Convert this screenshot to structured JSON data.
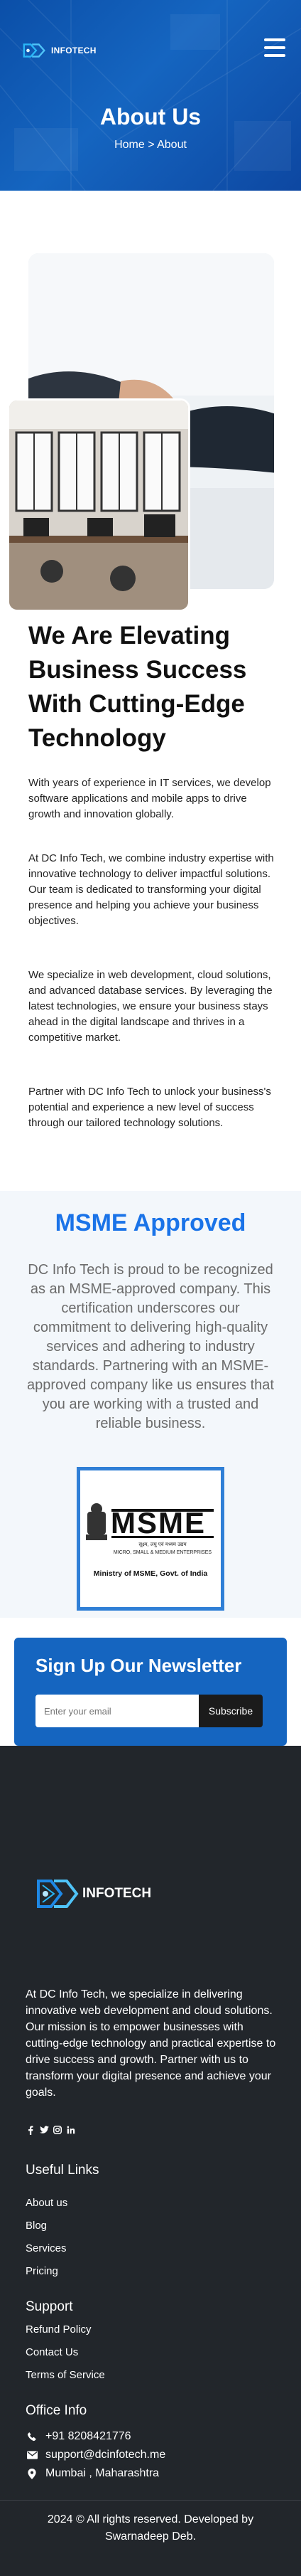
{
  "header": {
    "logo_text": "INFOTECH",
    "title": "About Us",
    "breadcrumb_home": "Home",
    "breadcrumb_sep": " > ",
    "breadcrumb_current": "About"
  },
  "about": {
    "title": "We Are Elevating Business Success With Cutting-Edge Technology",
    "paragraphs": [
      "With years of experience in IT services, we develop software applications and mobile apps to drive growth and innovation globally.",
      "At DC Info Tech, we combine industry expertise with innovative technology to deliver impactful solutions. Our team is dedicated to transforming your digital presence and helping you achieve your business objectives.",
      "We specialize in web development, cloud solutions, and advanced database services. By leveraging the latest technologies, we ensure your business stays ahead in the digital landscape and thrives in a competitive market.",
      "Partner with DC Info Tech to unlock your business's potential and experience a new level of success through our tailored technology solutions."
    ]
  },
  "msme": {
    "title": "MSME Approved",
    "text": "DC Info Tech is proud to be recognized as an MSME-approved company. This certification underscores our commitment to delivering high-quality services and adhering to industry standards. Partnering with an MSME-approved company like us ensures that you are working with a trusted and reliable business.",
    "logo_word": "MSME",
    "logo_hindi": "सूक्ष्म, लघु एवं मध्यम उद्यम",
    "logo_sub": "MICRO, SMALL & MEDIUM ENTERPRISES",
    "logo_caption": "Ministry of MSME, Govt. of India"
  },
  "newsletter": {
    "title": "Sign Up Our Newsletter",
    "email_placeholder": "Enter your email",
    "button": "Subscribe"
  },
  "footer": {
    "logo_text": "INFOTECH",
    "about": "At DC Info Tech, we specialize in delivering innovative web development and cloud solutions. Our mission is to empower businesses with cutting-edge technology and practical expertise to drive success and growth. Partner with us to transform your digital presence and achieve your goals.",
    "useful_links_title": "Useful Links",
    "useful_links": [
      "About us",
      "Blog",
      "Services",
      "Pricing"
    ],
    "support_title": "Support",
    "support_links": [
      "Refund Policy",
      "Contact Us",
      "Terms of Service"
    ],
    "office_title": "Office Info",
    "phone": "+91 8208421776",
    "email": "support@dcinfotech.me",
    "address": "Mumbai , Maharashtra",
    "copyright": "2024 © All rights reserved. Developed by Swarnadeep Deb."
  },
  "colors": {
    "hero_blue": "#1565c0",
    "accent_blue": "#1a73e8",
    "footer_dark": "#22262b"
  }
}
